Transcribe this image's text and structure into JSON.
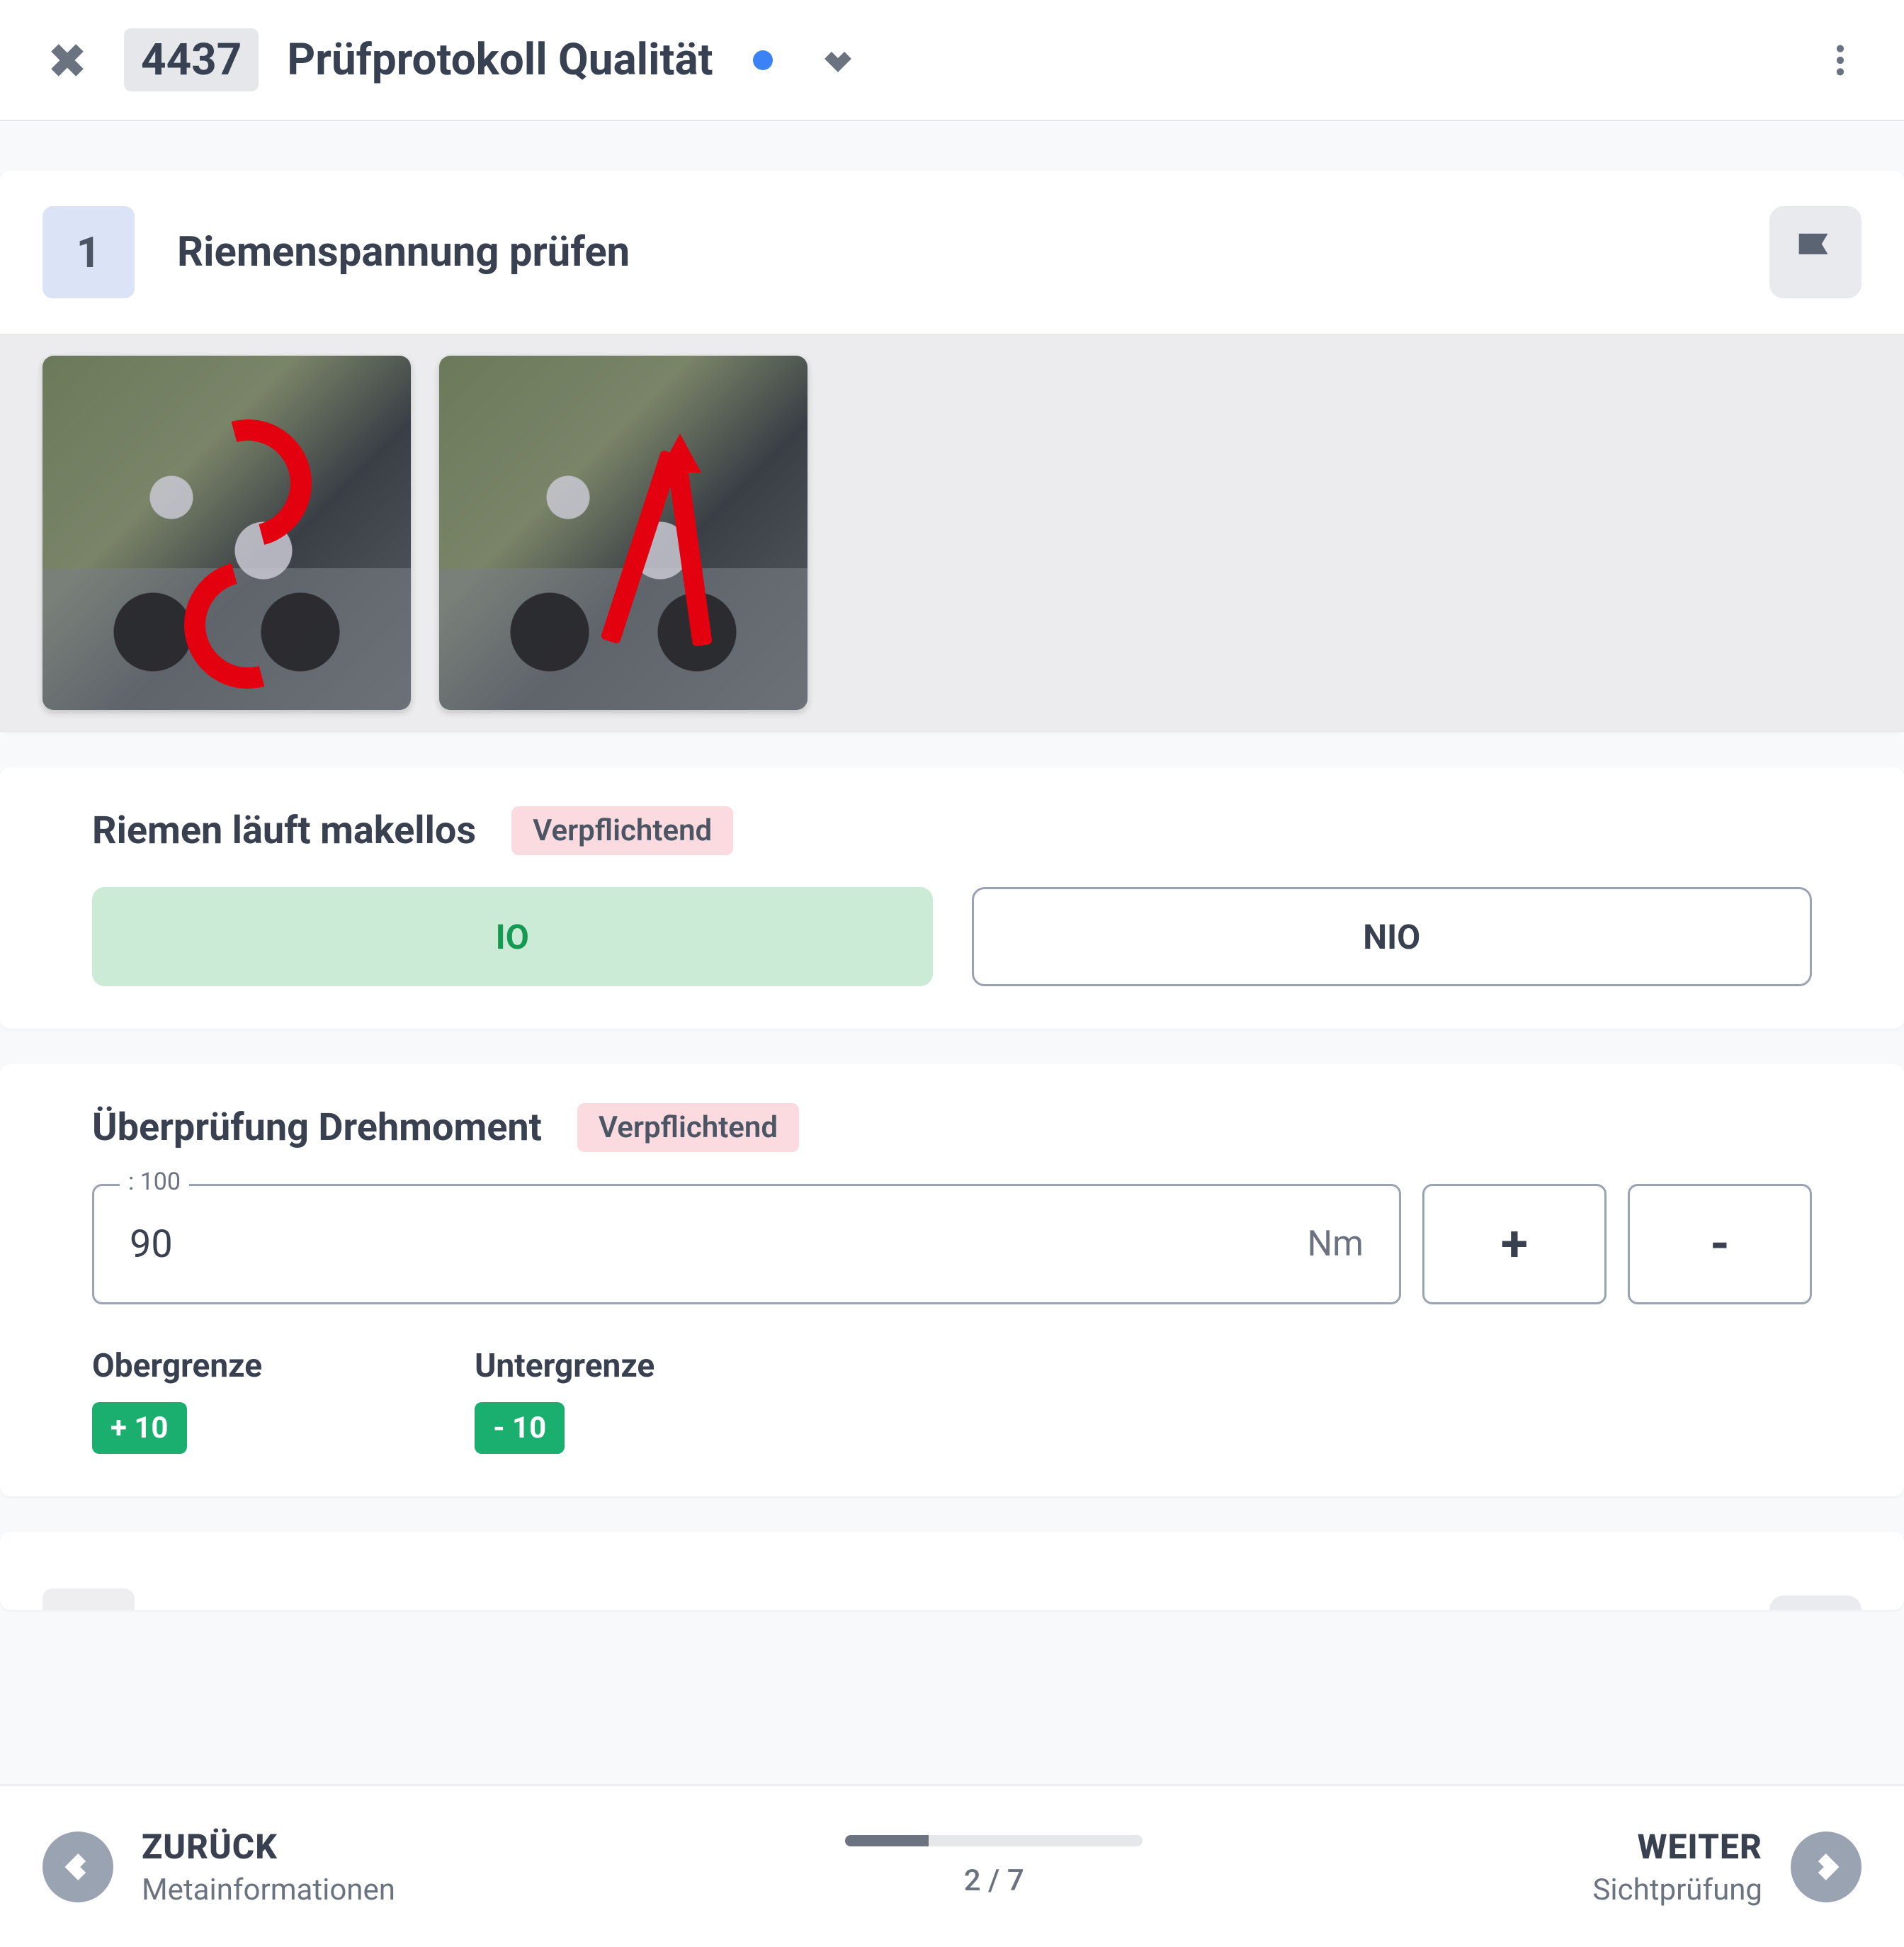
{
  "header": {
    "id": "4437",
    "title": "Prüfprotokoll Qualität",
    "status_color": "#3b82f6"
  },
  "step": {
    "number": "1",
    "title": "Riemenspannung prüfen"
  },
  "section_belt": {
    "title": "Riemen läuft makellos",
    "badge": "Verpflichtend",
    "option_ok": "IO",
    "option_nok": "NIO",
    "selected": "IO"
  },
  "section_torque": {
    "title": "Überprüfung Drehmoment",
    "badge": "Verpflichtend",
    "legend": ": 100",
    "value": "90",
    "unit": "Nm",
    "plus": "+",
    "minus": "-",
    "upper_label": "Obergrenze",
    "upper_value": "+ 10",
    "lower_label": "Untergrenze",
    "lower_value": "- 10"
  },
  "footer": {
    "back_label": "ZURÜCK",
    "back_sub": "Metainformationen",
    "next_label": "WEITER",
    "next_sub": "Sichtprüfung",
    "page_current": "2",
    "page_sep": " / ",
    "page_total": "7",
    "progress_percent": 28
  }
}
